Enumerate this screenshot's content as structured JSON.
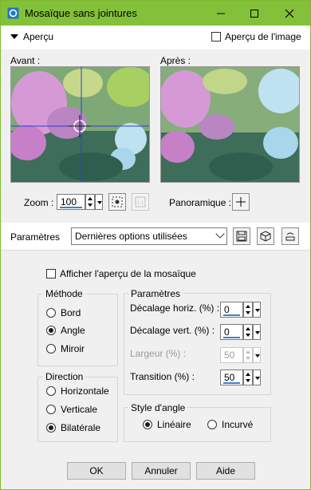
{
  "window": {
    "title": "Mosaïque sans jointures",
    "accent": "#84c13a"
  },
  "preview": {
    "toggle_label": "Aperçu",
    "image_preview_label": "Aperçu de l'image",
    "before_label": "Avant :",
    "after_label": "Après :"
  },
  "zoom": {
    "label": "Zoom :",
    "value": "100"
  },
  "panoramique": {
    "label": "Panoramique :"
  },
  "parametres_bar": {
    "label": "Paramètres",
    "preset": "Dernières options utilisées"
  },
  "mosaic_preview": {
    "label": "Afficher l'aperçu de la mosaïque"
  },
  "methode": {
    "title": "Méthode",
    "options": [
      "Bord",
      "Angle",
      "Miroir"
    ],
    "selected": "Angle"
  },
  "direction": {
    "title": "Direction",
    "options": [
      "Horizontale",
      "Verticale",
      "Bilatérale"
    ],
    "selected": "Bilatérale"
  },
  "params": {
    "title": "Paramètres",
    "horiz_label": "Décalage horiz. (%) :",
    "horiz_value": "0",
    "vert_label": "Décalage vert. (%) :",
    "vert_value": "0",
    "width_label": "Largeur (%) :",
    "width_value": "50",
    "transition_label": "Transition (%) :",
    "transition_value": "50"
  },
  "style_angle": {
    "title": "Style d'angle",
    "options": [
      "Linéaire",
      "Incurvé"
    ],
    "selected": "Linéaire"
  },
  "buttons": {
    "ok": "OK",
    "cancel": "Annuler",
    "help": "Aide"
  }
}
